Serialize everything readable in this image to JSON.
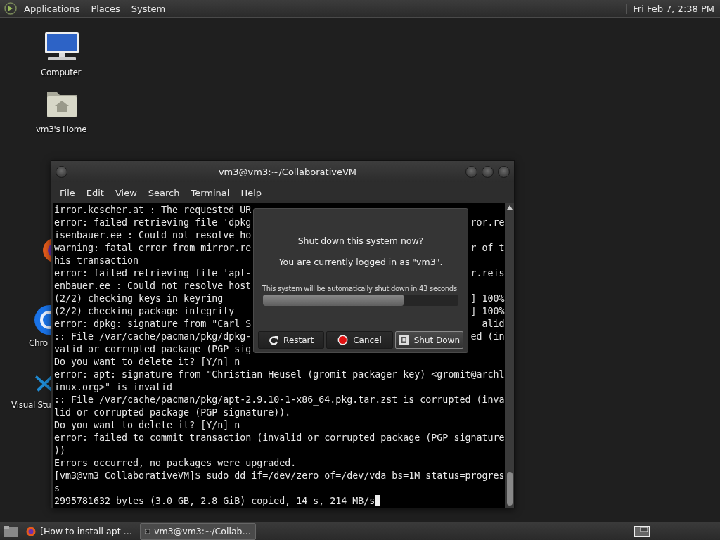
{
  "top_panel": {
    "menus": [
      "Applications",
      "Places",
      "System"
    ],
    "clock": "Fri Feb 7, 2:38 PM"
  },
  "desktop_icons": [
    {
      "kind": "computer",
      "label": "Computer"
    },
    {
      "kind": "home",
      "label": "vm3's Home"
    },
    {
      "kind": "firefox"
    },
    {
      "kind": "chrome",
      "label": "Chro"
    },
    {
      "kind": "vscode",
      "label": "Visual Stu"
    }
  ],
  "terminal": {
    "title": "vm3@vm3:~/CollaborativeVM",
    "menus": [
      "File",
      "Edit",
      "View",
      "Search",
      "Terminal",
      "Help"
    ],
    "lines": [
      {
        "text": "irror.kescher.at : The requested UR"
      },
      {
        "text": "error: failed retrieving file 'dpkg",
        "right": "ror.re"
      },
      {
        "text": "isenbauer.ee : Could not resolve ho"
      },
      {
        "text": "warning: fatal error from mirror.re",
        "right": "r of t"
      },
      {
        "text": "his transaction"
      },
      {
        "text": "error: failed retrieving file 'apt-",
        "right": "r.reis"
      },
      {
        "text": "enbauer.ee : Could not resolve host"
      },
      {
        "text": "(2/2) checking keys in keyring",
        "right": "] 100%"
      },
      {
        "text": "(2/2) checking package integrity",
        "right": "] 100%"
      },
      {
        "text": "error: dpkg: signature from \"Carl S",
        "right": "alid"
      },
      {
        "text": ":: File /var/cache/pacman/pkg/dpkg-",
        "right": "ed (in"
      },
      {
        "text": "valid or corrupted package (PGP sig"
      },
      {
        "text": "Do you want to delete it? [Y/n] n"
      },
      {
        "text": "error: apt: signature from \"Christian Heusel (gromit packager key) <gromit@archl"
      },
      {
        "text": "inux.org>\" is invalid"
      },
      {
        "text": ":: File /var/cache/pacman/pkg/apt-2.9.10-1-x86_64.pkg.tar.zst is corrupted (inva"
      },
      {
        "text": "lid or corrupted package (PGP signature))."
      },
      {
        "text": "Do you want to delete it? [Y/n] n"
      },
      {
        "text": "error: failed to commit transaction (invalid or corrupted package (PGP signature"
      },
      {
        "text": "))"
      },
      {
        "text": "Errors occurred, no packages were upgraded."
      },
      {
        "text": "[vm3@vm3 CollaborativeVM]$ sudo dd if=/dev/zero of=/dev/vda bs=1M status=progres"
      },
      {
        "text": "s"
      },
      {
        "text": "2995781632 bytes (3.0 GB, 2.8 GiB) copied, 14 s, 214 MB/s",
        "cursor": true
      }
    ]
  },
  "dialog": {
    "question": "Shut down this system now?",
    "user_note": "You are currently logged in as \"vm3\".",
    "countdown": "This system will be automatically shut down in 43 seconds",
    "progress": {
      "level": 0.72
    },
    "buttons": [
      {
        "kind": "restart",
        "label": "Restart",
        "selected": false
      },
      {
        "kind": "cancel",
        "label": "Cancel",
        "selected": false
      },
      {
        "kind": "shutdown",
        "label": "Shut Down",
        "selected": true
      }
    ]
  },
  "taskbar": {
    "items": [
      {
        "kind": "browser",
        "label": "[How to install apt …",
        "selected": false
      },
      {
        "kind": "terminal",
        "label": "vm3@vm3:~/Collab…",
        "selected": true
      }
    ]
  }
}
